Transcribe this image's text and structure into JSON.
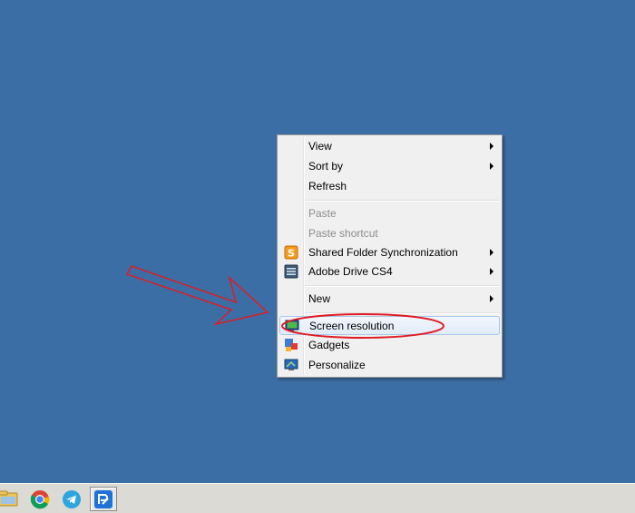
{
  "context_menu": {
    "items": [
      {
        "label": "View",
        "submenu": true,
        "enabled": true,
        "icon": ""
      },
      {
        "label": "Sort by",
        "submenu": true,
        "enabled": true,
        "icon": ""
      },
      {
        "label": "Refresh",
        "submenu": false,
        "enabled": true,
        "icon": ""
      },
      {
        "label": "Paste",
        "submenu": false,
        "enabled": false,
        "icon": ""
      },
      {
        "label": "Paste shortcut",
        "submenu": false,
        "enabled": false,
        "icon": ""
      },
      {
        "label": "Shared Folder Synchronization",
        "submenu": true,
        "enabled": true,
        "icon": "shared-folder-sync-icon",
        "icon_glyph": "S"
      },
      {
        "label": "Adobe Drive CS4",
        "submenu": true,
        "enabled": true,
        "icon": "adobe-drive-icon"
      },
      {
        "label": "New",
        "submenu": true,
        "enabled": true,
        "icon": ""
      },
      {
        "label": "Screen resolution",
        "submenu": false,
        "enabled": true,
        "icon": "screen-resolution-icon",
        "highlighted": true
      },
      {
        "label": "Gadgets",
        "submenu": false,
        "enabled": true,
        "icon": "gadgets-icon"
      },
      {
        "label": "Personalize",
        "submenu": false,
        "enabled": true,
        "icon": "personalize-icon"
      }
    ]
  },
  "taskbar": {
    "icons": [
      "file-explorer-icon",
      "chrome-icon",
      "telegram-icon",
      "pinned-app-icon"
    ],
    "active_icon": "pinned-app-icon"
  },
  "colors": {
    "desktop": "#3b6ea5",
    "annotation_red": "#e01b24",
    "menu_bg": "#f0f0f0",
    "highlight_border": "#a8c8ec"
  }
}
